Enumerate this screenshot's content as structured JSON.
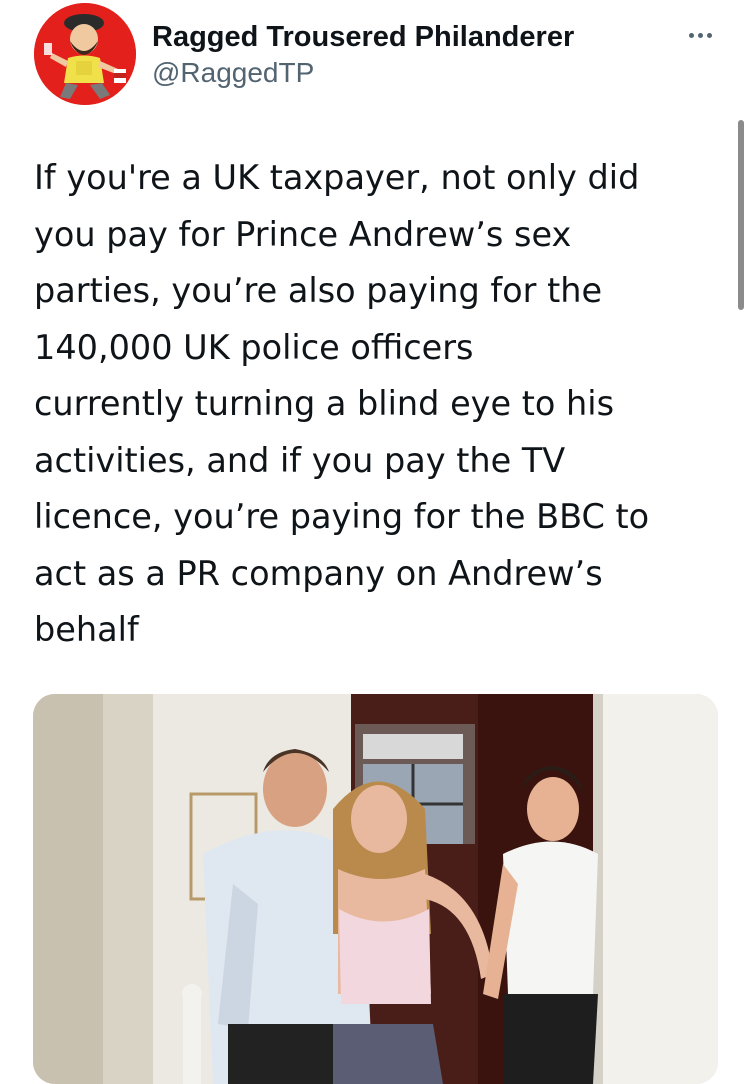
{
  "author": {
    "display_name": "Ragged Trousered Philanderer",
    "handle": "@RaggedTP"
  },
  "tweet": {
    "text": "If you're a UK taxpayer, not only did\nyou pay for Prince Andrew’s sex\nparties, you’re also paying for the\n140,000 UK police officers\ncurrently turning a blind eye to his\nactivities, and if you pay the TV\nlicence, you’re paying for the BBC to\nact as a PR company on Andrew’s\nbehalf"
  },
  "icons": {
    "more": "more-horizontal-icon"
  },
  "colors": {
    "text": "#0f1419",
    "secondary": "#536471",
    "avatar_bg": "#e3201c"
  }
}
